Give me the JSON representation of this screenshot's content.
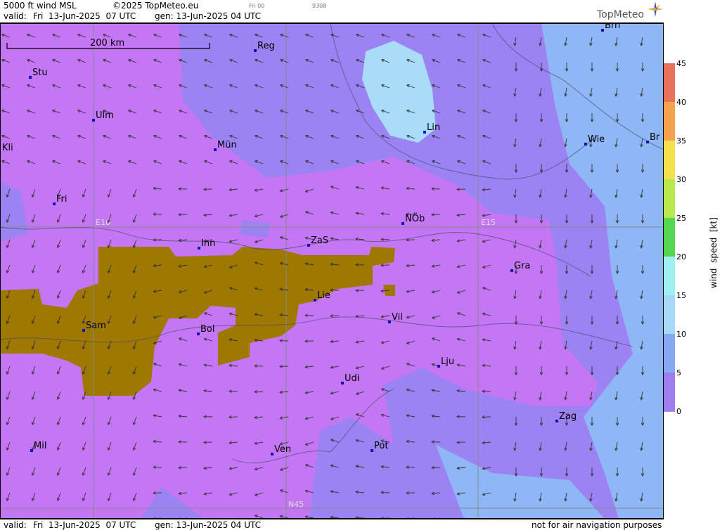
{
  "header": {
    "product": "5000 ft wind MSL",
    "copyright": "©2025 TopMeteo.eu",
    "valid_label": "valid:",
    "valid_time": "Fri  13-Jun-2025  07 UTC",
    "gen_time": "gen: 13-Jun-2025 04 UTC",
    "small_day": "Fri 00",
    "small_code": "9308",
    "logo": "TopMeteo"
  },
  "footer": {
    "valid_label": "valid:",
    "valid_time": "Fri  13-Jun-2025  07 UTC",
    "gen_time": "gen: 13-Jun-2025 04 UTC",
    "disclaimer": "not for air navigation purposes"
  },
  "scale_bar": "200 km",
  "grid_labels": {
    "e10": "E10",
    "e15": "E15",
    "n45": "N45"
  },
  "cities": [
    {
      "name": "Brn"
    },
    {
      "name": "Reg"
    },
    {
      "name": "Stu"
    },
    {
      "name": "Ulm"
    },
    {
      "name": "Lin"
    },
    {
      "name": "Kli"
    },
    {
      "name": "Mün"
    },
    {
      "name": "Wie"
    },
    {
      "name": "Br"
    },
    {
      "name": "Fri"
    },
    {
      "name": "NÖb"
    },
    {
      "name": "Inn"
    },
    {
      "name": "ZaS"
    },
    {
      "name": "Gra"
    },
    {
      "name": "Lie"
    },
    {
      "name": "Sam"
    },
    {
      "name": "Bol"
    },
    {
      "name": "Vil"
    },
    {
      "name": "Lju"
    },
    {
      "name": "Udi"
    },
    {
      "name": "Zag"
    },
    {
      "name": "Mil"
    },
    {
      "name": "Ven"
    },
    {
      "name": "Pot"
    }
  ],
  "legend": {
    "title": "wind  speed  [kt]",
    "ticks": [
      "45",
      "40",
      "35",
      "30",
      "25",
      "20",
      "15",
      "10",
      "5",
      "0"
    ],
    "colors": [
      "#e8735a",
      "#f4a24c",
      "#f5e14e",
      "#b9e84c",
      "#55d64f",
      "#9ff0f0",
      "#a6d8f7",
      "#86a9f5",
      "#9f7ff0",
      "#c47cf2"
    ]
  },
  "colors": {
    "band_0_5": "#c476f5",
    "band_5_10": "#9b83f3",
    "band_10_15": "#8fb7f6",
    "band_15_20": "#a8dcf8",
    "terrain": "#9e7800"
  }
}
